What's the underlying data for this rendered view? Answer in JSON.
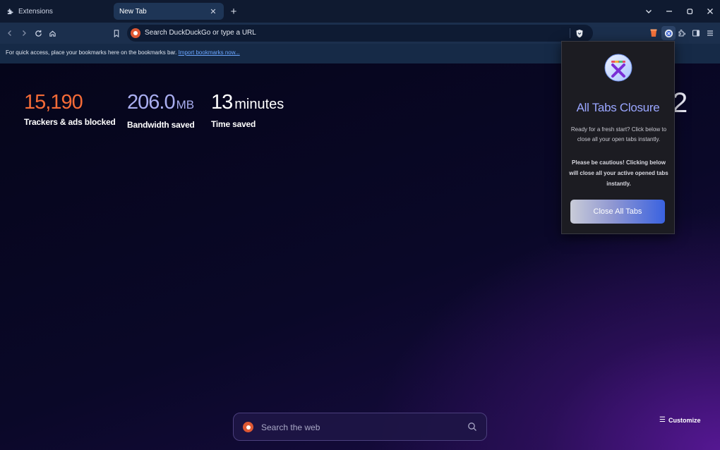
{
  "tabs": [
    {
      "label": "Extensions"
    },
    {
      "label": "New Tab"
    }
  ],
  "omnibox": {
    "text": "Search DuckDuckGo or type a URL"
  },
  "bookmarks_bar": {
    "message": "For quick access, place your bookmarks here on the bookmarks bar.",
    "link": "Import bookmarks now..."
  },
  "stats": {
    "trackers": {
      "value": "15,190",
      "label": "Trackers & ads blocked"
    },
    "bandwidth": {
      "value": "206.0",
      "unit": "MB",
      "label": "Bandwidth saved"
    },
    "time": {
      "value": "13",
      "unit": "minutes",
      "label": "Time saved"
    }
  },
  "clock_peek": "2",
  "search_web": {
    "placeholder": "Search the web"
  },
  "customize": {
    "label": "Customize"
  },
  "popup": {
    "title": "All Tabs Closure",
    "description": "Ready for a fresh start? Click below to close all your open tabs instantly.",
    "warning": "Please be cautious! Clicking below will close all your active opened tabs instantly.",
    "button": "Close All Tabs"
  },
  "colors": {
    "trackers": "#f46b37",
    "bandwidth": "#a9aef0",
    "popup_title": "#9aa6ff",
    "button_end": "#3a62e0"
  }
}
